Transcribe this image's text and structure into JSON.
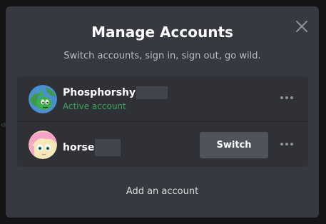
{
  "modal": {
    "title": "Manage Accounts",
    "subtitle": "Switch accounts, sign in, sign out, go wild.",
    "close_icon": "close-icon"
  },
  "accounts": [
    {
      "name": "Phosphorshy",
      "status": "Active account",
      "avatar_icon": "green-character-avatar",
      "more_icon": "more-horizontal-icon",
      "status_color": "#3ba55c"
    },
    {
      "name": "horse",
      "action_label": "Switch",
      "avatar_icon": "pink-character-avatar",
      "more_icon": "more-horizontal-icon"
    }
  ],
  "footer": {
    "add_label": "Add an account"
  },
  "colors": {
    "modal_bg": "#36393f",
    "row_bg": "#2f3136",
    "button_bg": "#4f545c",
    "active_green": "#3ba55c"
  }
}
